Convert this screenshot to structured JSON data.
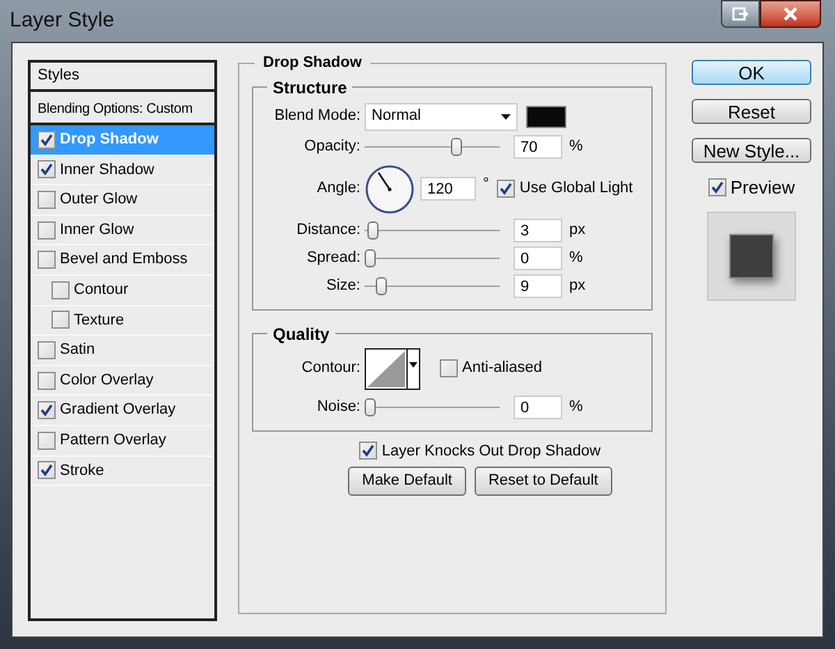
{
  "window": {
    "title": "Layer Style"
  },
  "styles_list": {
    "header": "Styles",
    "items": [
      {
        "label": "Blending Options: Custom",
        "kind": "plain",
        "selected": false
      },
      {
        "label": "Drop Shadow",
        "kind": "check",
        "checked": true,
        "selected": true
      },
      {
        "label": "Inner Shadow",
        "kind": "check",
        "checked": true,
        "selected": false
      },
      {
        "label": "Outer Glow",
        "kind": "check",
        "checked": false,
        "selected": false
      },
      {
        "label": "Inner Glow",
        "kind": "check",
        "checked": false,
        "selected": false
      },
      {
        "label": "Bevel and Emboss",
        "kind": "check",
        "checked": false,
        "selected": false
      },
      {
        "label": "Contour",
        "kind": "subcheck",
        "checked": false,
        "selected": false
      },
      {
        "label": "Texture",
        "kind": "subcheck",
        "checked": false,
        "selected": false
      },
      {
        "label": "Satin",
        "kind": "check",
        "checked": false,
        "selected": false
      },
      {
        "label": "Color Overlay",
        "kind": "check",
        "checked": false,
        "selected": false
      },
      {
        "label": "Gradient Overlay",
        "kind": "check",
        "checked": true,
        "selected": false
      },
      {
        "label": "Pattern Overlay",
        "kind": "check",
        "checked": false,
        "selected": false
      },
      {
        "label": "Stroke",
        "kind": "check",
        "checked": true,
        "selected": false
      }
    ]
  },
  "panel": {
    "title": "Drop Shadow",
    "structure": {
      "title": "Structure",
      "rows": [
        {
          "kind": "dropdown",
          "label": "Blend Mode:",
          "value": "Normal"
        },
        {
          "kind": "slider",
          "label": "Opacity:",
          "level": 0.7,
          "value": "70",
          "unit": "%"
        },
        {
          "kind": "angle",
          "label": "Angle:",
          "value": "120",
          "unit": "°",
          "checkbox": {
            "label": "Use Global Light",
            "checked": true
          }
        },
        {
          "kind": "slider",
          "label": "Distance:",
          "level": 0.02,
          "value": "3",
          "unit": "px"
        },
        {
          "kind": "slider",
          "label": "Spread:",
          "level": 0,
          "value": "0",
          "unit": "%"
        },
        {
          "kind": "slider",
          "label": "Size:",
          "level": 0.09,
          "value": "9",
          "unit": "px"
        }
      ]
    },
    "quality": {
      "title": "Quality",
      "contour_label": "Contour:",
      "anti_aliased": {
        "label": "Anti-aliased",
        "checked": false
      },
      "noise": {
        "label": "Noise:",
        "level": 0,
        "value": "0",
        "unit": "%"
      }
    },
    "knockout": {
      "label": "Layer Knocks Out Drop Shadow",
      "checked": true
    },
    "buttons": [
      "Make Default",
      "Reset to Default"
    ]
  },
  "side": {
    "buttons": [
      {
        "label": "OK",
        "default": true
      },
      {
        "label": "Reset",
        "default": false
      },
      {
        "label": "New Style...",
        "default": false
      }
    ],
    "preview": {
      "label": "Preview",
      "checked": true
    }
  }
}
